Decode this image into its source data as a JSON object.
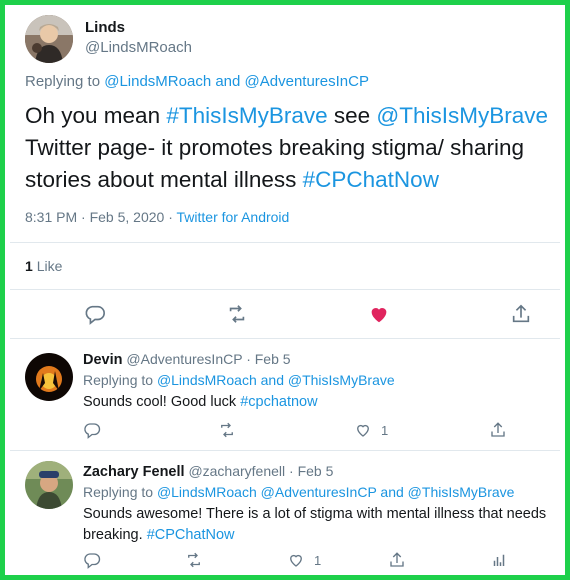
{
  "main_tweet": {
    "display_name": "Linds",
    "handle": "@LindsMRoach",
    "replying_prefix": "Replying to",
    "replying_to": "@LindsMRoach and @AdventuresInCP",
    "text": {
      "p1": "Oh you mean ",
      "h1": "#ThisIsMyBrave",
      "p2": " see ",
      "h2": "@ThisIsMyBrave",
      "p3": " Twitter page- it promotes breaking stigma/ sharing stories about mental illness ",
      "h3": "#CPChatNow"
    },
    "time": "8:31 PM · Feb 5, 2020 ·",
    "source": "Twitter for Android",
    "like_count": "1",
    "like_label": "Like"
  },
  "replies": [
    {
      "display_name": "Devin",
      "handle": "@AdventuresInCP",
      "date": "· Feb 5",
      "replying_prefix": "Replying to",
      "replying_to": "@LindsMRoach and @ThisIsMyBrave",
      "text_plain": "Sounds cool! Good luck ",
      "text_hashtag": "#cpchatnow",
      "like_count": "1"
    },
    {
      "display_name": "Zachary Fenell",
      "handle": "@zacharyfenell",
      "date": "· Feb 5",
      "replying_prefix": "Replying to",
      "replying_to": "@LindsMRoach @AdventuresInCP and @ThisIsMyBrave",
      "text_plain": "Sounds awesome! There is a lot of stigma with mental illness that needs breaking. ",
      "text_hashtag": "#CPChatNow",
      "like_count": "1"
    }
  ],
  "colors": {
    "frame": "#1ed04a",
    "link": "#1b95e0",
    "muted": "#657786",
    "liked": "#e0245e"
  },
  "icons": [
    "reply-icon",
    "retweet-icon",
    "heart-icon",
    "share-icon",
    "analytics-icon"
  ]
}
